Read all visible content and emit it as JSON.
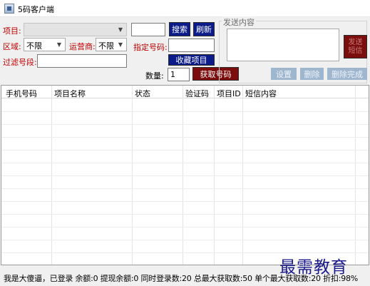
{
  "window": {
    "title": "5码客户端"
  },
  "form": {
    "project_label": "项目:",
    "region_label": "区域:",
    "region_value": "不限",
    "carrier_label": "运营商:",
    "carrier_value": "不限",
    "filter_label": "过滤号段:",
    "specified_label": "指定号码:",
    "quantity_label": "数量:",
    "quantity_value": "1"
  },
  "buttons": {
    "search": "搜索",
    "refresh": "刷新",
    "favorite": "收藏项目",
    "get_number": "获取号码",
    "settings": "设置",
    "delete": "删除",
    "delete_done": "删除完成",
    "send_sms": "发送 短信"
  },
  "sms": {
    "group_title": "发送内容"
  },
  "table": {
    "columns": [
      "手机号码",
      "项目名称",
      "状态",
      "验证码",
      "项目ID",
      "短信内容"
    ],
    "rows": []
  },
  "status": {
    "text": "我是大傻逼，已登录 余额:0 提现余额:0 同时登录数:20 总最大获取数:50 单个最大获取数:20 折扣:98%"
  },
  "watermark": "最需教育",
  "colors": {
    "primary_button": "#0b1c8a",
    "danger_button": "#7b0d0d",
    "disabled_button": "#9fb6cf",
    "label_red": "#c00000",
    "watermark": "#1a1a8c"
  }
}
